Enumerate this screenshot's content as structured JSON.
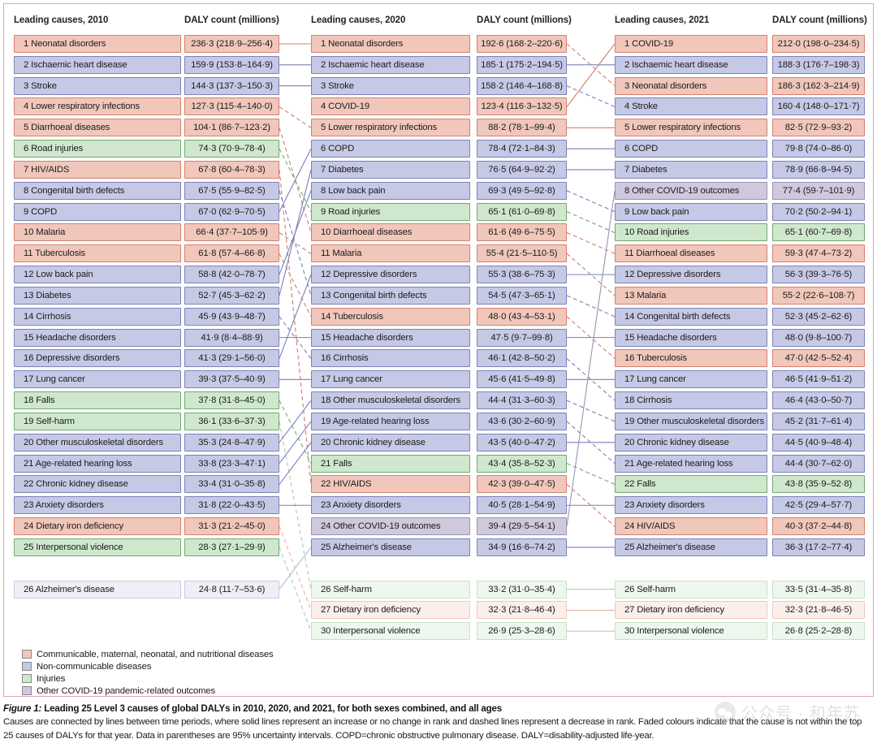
{
  "figure": {
    "caption_label": "Figure 1:",
    "caption_title": " Leading 25 Level 3 causes of global DALYs in 2010, 2020, and 2021, for both sexes combined, and all ages",
    "caption_body": "Causes are connected by lines between time periods, where solid lines represent an increase or no change in rank and dashed lines represent a decrease in rank. Faded colours indicate that the cause is not within the top 25 causes of DALYs for that year. Data in parentheses are 95% uncertainty intervals. COPD=chronic obstructive pulmonary disease. DALY=disability-adjusted life-year."
  },
  "watermark": {
    "text": "公众号 · 和年苏"
  },
  "colors": {
    "panel_border": "#e8a0b4",
    "cmnn_fill": "#f1c7bb",
    "cmnn_border": "#d8806c",
    "ncd_fill": "#c6c9e5",
    "ncd_border": "#7b82ba",
    "inj_fill": "#cfe8cd",
    "inj_border": "#6faa6d",
    "covidoth_fill": "#cfc9dd",
    "covidoth_border": "#9a94b4"
  },
  "legend": {
    "items": [
      {
        "label": "Communicable, maternal, neonatal, and nutritional diseases",
        "category": "cmnn"
      },
      {
        "label": "Non-communicable diseases",
        "category": "ncd"
      },
      {
        "label": "Injuries",
        "category": "inj"
      },
      {
        "label": "Other COVID-19 pandemic-related outcomes",
        "category": "covidoth"
      }
    ]
  },
  "columns": [
    {
      "year": "2010",
      "head_cause": "Leading causes, 2010",
      "head_value": "DALY count (millions)",
      "rows": [
        {
          "rank": "1",
          "cause": "Neonatal disorders",
          "value": "236·3 (218·9–256·4)",
          "category": "cmnn",
          "faded": false
        },
        {
          "rank": "2",
          "cause": "Ischaemic heart disease",
          "value": "159·9 (153·8–164·9)",
          "category": "ncd",
          "faded": false
        },
        {
          "rank": "3",
          "cause": "Stroke",
          "value": "144·3 (137·3–150·3)",
          "category": "ncd",
          "faded": false
        },
        {
          "rank": "4",
          "cause": "Lower respiratory infections",
          "value": "127·3 (115·4–140·0)",
          "category": "cmnn",
          "faded": false
        },
        {
          "rank": "5",
          "cause": "Diarrhoeal diseases",
          "value": "104·1 (86·7–123·2)",
          "category": "cmnn",
          "faded": false
        },
        {
          "rank": "6",
          "cause": "Road injuries",
          "value": "74·3 (70·9–78·4)",
          "category": "inj",
          "faded": false
        },
        {
          "rank": "7",
          "cause": "HIV/AIDS",
          "value": "67·8 (60·4–78·3)",
          "category": "cmnn",
          "faded": false
        },
        {
          "rank": "8",
          "cause": "Congenital birth defects",
          "value": "67·5 (55·9–82·5)",
          "category": "ncd",
          "faded": false
        },
        {
          "rank": "9",
          "cause": "COPD",
          "value": "67·0 (62·9–70·5)",
          "category": "ncd",
          "faded": false
        },
        {
          "rank": "10",
          "cause": "Malaria",
          "value": "66·4 (37·7–105·9)",
          "category": "cmnn",
          "faded": false
        },
        {
          "rank": "11",
          "cause": "Tuberculosis",
          "value": "61·8 (57·4–66·8)",
          "category": "cmnn",
          "faded": false
        },
        {
          "rank": "12",
          "cause": "Low back pain",
          "value": "58·8 (42·0–78·7)",
          "category": "ncd",
          "faded": false
        },
        {
          "rank": "13",
          "cause": "Diabetes",
          "value": "52·7 (45·3–62·2)",
          "category": "ncd",
          "faded": false
        },
        {
          "rank": "14",
          "cause": "Cirrhosis",
          "value": "45·9 (43·9–48·7)",
          "category": "ncd",
          "faded": false
        },
        {
          "rank": "15",
          "cause": "Headache disorders",
          "value": "41·9 (8·4–88·9)",
          "category": "ncd",
          "faded": false
        },
        {
          "rank": "16",
          "cause": "Depressive disorders",
          "value": "41·3 (29·1–56·0)",
          "category": "ncd",
          "faded": false
        },
        {
          "rank": "17",
          "cause": "Lung cancer",
          "value": "39·3 (37·5–40·9)",
          "category": "ncd",
          "faded": false
        },
        {
          "rank": "18",
          "cause": "Falls",
          "value": "37·8 (31·8–45·0)",
          "category": "inj",
          "faded": false
        },
        {
          "rank": "19",
          "cause": "Self-harm",
          "value": "36·1 (33·6–37·3)",
          "category": "inj",
          "faded": false
        },
        {
          "rank": "20",
          "cause": "Other musculoskeletal disorders",
          "value": "35·3 (24·8–47·9)",
          "category": "ncd",
          "faded": false
        },
        {
          "rank": "21",
          "cause": "Age-related hearing loss",
          "value": "33·8 (23·3–47·1)",
          "category": "ncd",
          "faded": false
        },
        {
          "rank": "22",
          "cause": "Chronic kidney disease",
          "value": "33·4 (31·0–35·8)",
          "category": "ncd",
          "faded": false
        },
        {
          "rank": "23",
          "cause": "Anxiety disorders",
          "value": "31·8 (22·0–43·5)",
          "category": "ncd",
          "faded": false
        },
        {
          "rank": "24",
          "cause": "Dietary iron deficiency",
          "value": "31·3 (21·2–45·0)",
          "category": "cmnn",
          "faded": false
        },
        {
          "rank": "25",
          "cause": "Interpersonal violence",
          "value": "28·3 (27·1–29·9)",
          "category": "inj",
          "faded": false
        },
        {
          "rank": "26",
          "cause": "Alzheimer's disease",
          "value": "24·8 (11·7–53·6)",
          "category": "ncd",
          "faded": true,
          "slot": 27
        }
      ]
    },
    {
      "year": "2020",
      "head_cause": "Leading causes, 2020",
      "head_value": "DALY count (millions)",
      "rows": [
        {
          "rank": "1",
          "cause": "Neonatal disorders",
          "value": "192·6 (168·2–220·6)",
          "category": "cmnn",
          "faded": false
        },
        {
          "rank": "2",
          "cause": "Ischaemic heart disease",
          "value": "185·1 (175·2–194·5)",
          "category": "ncd",
          "faded": false
        },
        {
          "rank": "3",
          "cause": "Stroke",
          "value": "158·2 (146·4–168·8)",
          "category": "ncd",
          "faded": false
        },
        {
          "rank": "4",
          "cause": "COVID-19",
          "value": "123·4 (116·3–132·5)",
          "category": "cmnn",
          "faded": false
        },
        {
          "rank": "5",
          "cause": "Lower respiratory infections",
          "value": "88·2 (78·1–99·4)",
          "category": "cmnn",
          "faded": false
        },
        {
          "rank": "6",
          "cause": "COPD",
          "value": "78·4 (72·1–84·3)",
          "category": "ncd",
          "faded": false
        },
        {
          "rank": "7",
          "cause": "Diabetes",
          "value": "76·5 (64·9–92·2)",
          "category": "ncd",
          "faded": false
        },
        {
          "rank": "8",
          "cause": "Low back pain",
          "value": "69·3 (49·5–92·8)",
          "category": "ncd",
          "faded": false
        },
        {
          "rank": "9",
          "cause": "Road injuries",
          "value": "65·1 (61·0–69·8)",
          "category": "inj",
          "faded": false
        },
        {
          "rank": "10",
          "cause": "Diarrhoeal diseases",
          "value": "61·6 (49·6–75·5)",
          "category": "cmnn",
          "faded": false
        },
        {
          "rank": "11",
          "cause": "Malaria",
          "value": "55·4 (21·5–110·5)",
          "category": "cmnn",
          "faded": false
        },
        {
          "rank": "12",
          "cause": "Depressive disorders",
          "value": "55·3 (38·6–75·3)",
          "category": "ncd",
          "faded": false
        },
        {
          "rank": "13",
          "cause": "Congenital birth defects",
          "value": "54·5 (47·3–65·1)",
          "category": "ncd",
          "faded": false
        },
        {
          "rank": "14",
          "cause": "Tuberculosis",
          "value": "48·0 (43·4–53·1)",
          "category": "cmnn",
          "faded": false
        },
        {
          "rank": "15",
          "cause": "Headache disorders",
          "value": "47·5 (9·7–99·8)",
          "category": "ncd",
          "faded": false
        },
        {
          "rank": "16",
          "cause": "Cirrhosis",
          "value": "46·1 (42·8–50·2)",
          "category": "ncd",
          "faded": false
        },
        {
          "rank": "17",
          "cause": "Lung cancer",
          "value": "45·6 (41·5–49·8)",
          "category": "ncd",
          "faded": false
        },
        {
          "rank": "18",
          "cause": "Other musculoskeletal disorders",
          "value": "44·4 (31·3–60·3)",
          "category": "ncd",
          "faded": false
        },
        {
          "rank": "19",
          "cause": "Age-related hearing loss",
          "value": "43·6 (30·2–60·9)",
          "category": "ncd",
          "faded": false
        },
        {
          "rank": "20",
          "cause": "Chronic kidney disease",
          "value": "43·5 (40·0–47·2)",
          "category": "ncd",
          "faded": false
        },
        {
          "rank": "21",
          "cause": "Falls",
          "value": "43·4 (35·8–52·3)",
          "category": "inj",
          "faded": false
        },
        {
          "rank": "22",
          "cause": "HIV/AIDS",
          "value": "42·3 (39·0–47·5)",
          "category": "cmnn",
          "faded": false
        },
        {
          "rank": "23",
          "cause": "Anxiety disorders",
          "value": "40·5 (28·1–54·9)",
          "category": "ncd",
          "faded": false
        },
        {
          "rank": "24",
          "cause": "Other COVID-19 outcomes",
          "value": "39·4 (29·5–54·1)",
          "category": "covidoth",
          "faded": false
        },
        {
          "rank": "25",
          "cause": "Alzheimer's disease",
          "value": "34·9 (16·6–74·2)",
          "category": "ncd",
          "faded": false
        },
        {
          "rank": "26",
          "cause": "Self-harm",
          "value": "33·2 (31·0–35·4)",
          "category": "inj",
          "faded": true,
          "slot": 27
        },
        {
          "rank": "27",
          "cause": "Dietary iron deficiency",
          "value": "32·3 (21·8–46·4)",
          "category": "cmnn",
          "faded": true,
          "slot": 28
        },
        {
          "rank": "30",
          "cause": "Interpersonal violence",
          "value": "26·9 (25·3–28·6)",
          "category": "inj",
          "faded": true,
          "slot": 29
        }
      ]
    },
    {
      "year": "2021",
      "head_cause": "Leading causes, 2021",
      "head_value": "DALY count (millions)",
      "rows": [
        {
          "rank": "1",
          "cause": "COVID-19",
          "value": "212·0 (198·0–234·5)",
          "category": "cmnn",
          "faded": false
        },
        {
          "rank": "2",
          "cause": "Ischaemic heart disease",
          "value": "188·3 (176·7–198·3)",
          "category": "ncd",
          "faded": false
        },
        {
          "rank": "3",
          "cause": "Neonatal disorders",
          "value": "186·3 (162·3–214·9)",
          "category": "cmnn",
          "faded": false
        },
        {
          "rank": "4",
          "cause": "Stroke",
          "value": "160·4 (148·0–171·7)",
          "category": "ncd",
          "faded": false
        },
        {
          "rank": "5",
          "cause": "Lower respiratory infections",
          "value": "82·5 (72·9–93·2)",
          "category": "cmnn",
          "faded": false
        },
        {
          "rank": "6",
          "cause": "COPD",
          "value": "79·8 (74·0–86·0)",
          "category": "ncd",
          "faded": false
        },
        {
          "rank": "7",
          "cause": "Diabetes",
          "value": "78·9 (66·8–94·5)",
          "category": "ncd",
          "faded": false
        },
        {
          "rank": "8",
          "cause": "Other COVID-19 outcomes",
          "value": "77·4 (59·7–101·9)",
          "category": "covidoth",
          "faded": false
        },
        {
          "rank": "9",
          "cause": "Low back pain",
          "value": "70·2 (50·2–94·1)",
          "category": "ncd",
          "faded": false
        },
        {
          "rank": "10",
          "cause": "Road injuries",
          "value": "65·1 (60·7–69·8)",
          "category": "inj",
          "faded": false
        },
        {
          "rank": "11",
          "cause": "Diarrhoeal diseases",
          "value": "59·3 (47·4–73·2)",
          "category": "cmnn",
          "faded": false
        },
        {
          "rank": "12",
          "cause": "Depressive disorders",
          "value": "56·3 (39·3–76·5)",
          "category": "ncd",
          "faded": false
        },
        {
          "rank": "13",
          "cause": "Malaria",
          "value": "55·2 (22·6–108·7)",
          "category": "cmnn",
          "faded": false
        },
        {
          "rank": "14",
          "cause": "Congenital birth defects",
          "value": "52·3 (45·2–62·6)",
          "category": "ncd",
          "faded": false
        },
        {
          "rank": "15",
          "cause": "Headache disorders",
          "value": "48·0 (9·8–100·7)",
          "category": "ncd",
          "faded": false
        },
        {
          "rank": "16",
          "cause": "Tuberculosis",
          "value": "47·0 (42·5–52·4)",
          "category": "cmnn",
          "faded": false
        },
        {
          "rank": "17",
          "cause": "Lung cancer",
          "value": "46·5 (41·9–51·2)",
          "category": "ncd",
          "faded": false
        },
        {
          "rank": "18",
          "cause": "Cirrhosis",
          "value": "46·4 (43·0–50·7)",
          "category": "ncd",
          "faded": false
        },
        {
          "rank": "19",
          "cause": "Other musculoskeletal disorders",
          "value": "45·2 (31·7–61·4)",
          "category": "ncd",
          "faded": false
        },
        {
          "rank": "20",
          "cause": "Chronic kidney disease",
          "value": "44·5 (40·9–48·4)",
          "category": "ncd",
          "faded": false
        },
        {
          "rank": "21",
          "cause": "Age-related hearing loss",
          "value": "44·4 (30·7–62·0)",
          "category": "ncd",
          "faded": false
        },
        {
          "rank": "22",
          "cause": "Falls",
          "value": "43·8 (35·9–52·8)",
          "category": "inj",
          "faded": false
        },
        {
          "rank": "23",
          "cause": "Anxiety disorders",
          "value": "42·5 (29·4–57·7)",
          "category": "ncd",
          "faded": false
        },
        {
          "rank": "24",
          "cause": "HIV/AIDS",
          "value": "40·3 (37·2–44·8)",
          "category": "cmnn",
          "faded": false
        },
        {
          "rank": "25",
          "cause": "Alzheimer's disease",
          "value": "36·3 (17·2–77·4)",
          "category": "ncd",
          "faded": false
        },
        {
          "rank": "26",
          "cause": "Self-harm",
          "value": "33·5 (31·4–35·8)",
          "category": "inj",
          "faded": true,
          "slot": 27
        },
        {
          "rank": "27",
          "cause": "Dietary iron deficiency",
          "value": "32·3 (21·8–46·5)",
          "category": "cmnn",
          "faded": true,
          "slot": 28
        },
        {
          "rank": "30",
          "cause": "Interpersonal violence",
          "value": "26·8 (25·2–28·8)",
          "category": "inj",
          "faded": true,
          "slot": 29
        }
      ]
    }
  ]
}
